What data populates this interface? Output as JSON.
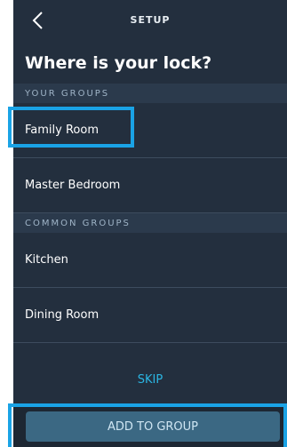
{
  "header": {
    "title": "SETUP",
    "back_icon": "chevron-left-icon"
  },
  "headline": "Where is your lock?",
  "your_groups": {
    "label": "YOUR GROUPS",
    "items": [
      {
        "label": "Family Room"
      },
      {
        "label": "Master Bedroom"
      }
    ]
  },
  "common_groups": {
    "label": "COMMON GROUPS",
    "items": [
      {
        "label": "Kitchen"
      },
      {
        "label": "Dining Room"
      }
    ]
  },
  "skip_label": "SKIP",
  "add_button_label": "ADD TO GROUP",
  "colors": {
    "background": "#232f3e",
    "section": "#2b3a4c",
    "accent": "#2bb6e3",
    "button": "#3b6883",
    "highlight": "#1aa3e6"
  }
}
